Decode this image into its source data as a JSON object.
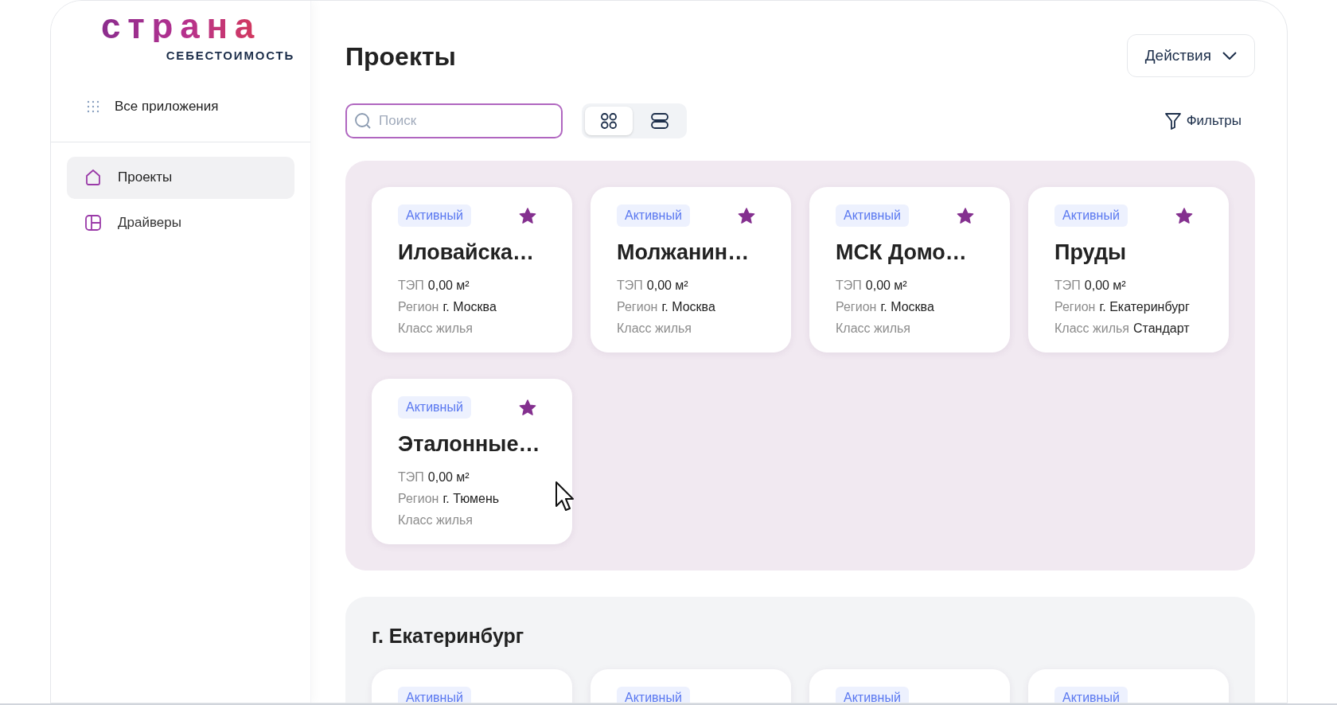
{
  "logo": {
    "wordmark": "страна",
    "subtitle": "СЕБЕСТОИМОСТЬ"
  },
  "sidebar": {
    "apps_link": "Все приложения",
    "items": [
      {
        "label": "Проекты",
        "kind": "home",
        "selected": true
      },
      {
        "label": "Драйверы",
        "kind": "drivers",
        "selected": false
      }
    ]
  },
  "page_title": "Проекты",
  "actions_button": "Действия",
  "search": {
    "placeholder": "Поиск"
  },
  "view_modes": [
    {
      "kind": "grid",
      "selected": true
    },
    {
      "kind": "list",
      "selected": false
    }
  ],
  "filters_button": "Фильтры",
  "sections": [
    {
      "kind": "favorites",
      "cards": [
        {
          "status": "Активный",
          "favorite": true,
          "title": "Иловайска…",
          "fields": [
            {
              "label": "ТЭП",
              "value": "0,00 м²"
            },
            {
              "label": "Регион",
              "value": "г. Москва"
            },
            {
              "label": "Класс жилья"
            }
          ]
        },
        {
          "status": "Активный",
          "favorite": true,
          "title": "Молжанин…",
          "fields": [
            {
              "label": "ТЭП",
              "value": "0,00 м²"
            },
            {
              "label": "Регион",
              "value": "г. Москва"
            },
            {
              "label": "Класс жилья"
            }
          ]
        },
        {
          "status": "Активный",
          "favorite": true,
          "title": "МСК Домо…",
          "fields": [
            {
              "label": "ТЭП",
              "value": "0,00 м²"
            },
            {
              "label": "Регион",
              "value": "г. Москва"
            },
            {
              "label": "Класс жилья"
            }
          ]
        },
        {
          "status": "Активный",
          "favorite": true,
          "title": "Пруды",
          "fields": [
            {
              "label": "ТЭП",
              "value": "0,00 м²"
            },
            {
              "label": "Регион",
              "value": "г. Екатеринбург"
            },
            {
              "label": "Класс жилья",
              "value": "Стандарт"
            }
          ]
        },
        {
          "status": "Активный",
          "favorite": true,
          "title": "Эталонные…",
          "fields": [
            {
              "label": "ТЭП",
              "value": "0,00 м²"
            },
            {
              "label": "Регион",
              "value": "г. Тюмень"
            },
            {
              "label": "Класс жилья"
            }
          ]
        }
      ]
    },
    {
      "kind": "region",
      "title": "г. Екатеринбург",
      "cards": [
        {
          "status": "Активный"
        },
        {
          "status": "Активный"
        },
        {
          "status": "Активный"
        },
        {
          "status": "Активный"
        }
      ]
    }
  ]
}
